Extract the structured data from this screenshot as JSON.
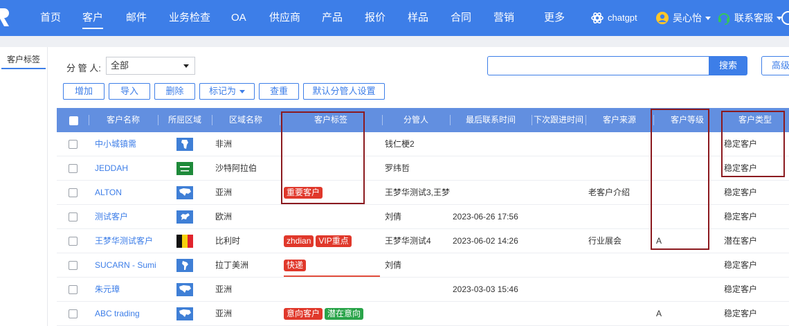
{
  "nav": {
    "items": [
      {
        "label": "首页",
        "active": false
      },
      {
        "label": "客户",
        "active": true
      },
      {
        "label": "邮件",
        "active": false
      },
      {
        "label": "业务检查",
        "active": false
      },
      {
        "label": "OA",
        "active": false
      },
      {
        "label": "供应商",
        "active": false
      },
      {
        "label": "产品",
        "active": false
      },
      {
        "label": "报价",
        "active": false
      },
      {
        "label": "样品",
        "active": false
      },
      {
        "label": "合同",
        "active": false
      },
      {
        "label": "营销",
        "active": false
      },
      {
        "label": "更多",
        "active": false
      }
    ],
    "chatgpt_label": "chatgpt",
    "user_name": "吴心怡",
    "support_label": "联系客服"
  },
  "sidebar": {
    "tab_label": "客户标签"
  },
  "filter": {
    "manager_label": "分 管 人:",
    "manager_value": "全部",
    "search_value": "",
    "search_button": "搜索",
    "advanced_button": "高级"
  },
  "toolbar": {
    "add": "增加",
    "import": "导入",
    "delete": "删除",
    "mark_as": "标记为",
    "check": "查重",
    "default_manager": "默认分管人设置"
  },
  "table": {
    "columns": [
      "客户名称",
      "所屈区域",
      "区域名称",
      "客户标签",
      "分管人",
      "最后联系时间",
      "下次跟进时间",
      "客户来源",
      "客户等级",
      "客户类型"
    ],
    "rows": [
      {
        "name": "中小城镇需",
        "flag": "africa-map",
        "region": "非洲",
        "tags": [],
        "manager": "钱仁梗2",
        "last_contact": "",
        "next_followup": "",
        "source": "",
        "level": "",
        "type": "稳定客户"
      },
      {
        "name": "JEDDAH",
        "flag": "saudi-arabia-flag",
        "region": "沙特阿拉伯",
        "tags": [],
        "manager": "罗纬哲",
        "last_contact": "",
        "next_followup": "",
        "source": "",
        "level": "",
        "type": "稳定客户"
      },
      {
        "name": "ALTON",
        "flag": "asia-map",
        "region": "亚洲",
        "tags": [
          {
            "label": "重要客户",
            "color": "#e0382b"
          }
        ],
        "manager": "王梦华测试3,王梦",
        "last_contact": "",
        "next_followup": "",
        "source": "老客户介绍",
        "level": "",
        "type": "稳定客户"
      },
      {
        "name": "测试客户",
        "flag": "europe-map",
        "region": "欧洲",
        "tags": [],
        "manager": "刘倩",
        "last_contact": "2023-06-26 17:56",
        "next_followup": "",
        "source": "",
        "level": "",
        "type": "稳定客户"
      },
      {
        "name": "王梦华测试客户",
        "flag": "belgium-flag",
        "region": "比利时",
        "tags": [
          {
            "label": "zhdian",
            "color": "#e0382b"
          },
          {
            "label": "VIP重点",
            "color": "#e0382b"
          }
        ],
        "manager": "王梦华测试4",
        "last_contact": "2023-06-02 14:26",
        "next_followup": "",
        "source": "行业展会",
        "level": "A",
        "type": "潜在客户"
      },
      {
        "name": "SUCARN - Sumi",
        "flag": "latin-america-map",
        "region": "拉丁美洲",
        "tags": [
          {
            "label": "快递",
            "color": "#e0382b"
          }
        ],
        "manager": "刘倩",
        "last_contact": "",
        "next_followup": "",
        "source": "",
        "level": "",
        "type": "稳定客户"
      },
      {
        "name": "朱元璋",
        "flag": "asia-map",
        "region": "亚洲",
        "tags": [],
        "manager": "",
        "last_contact": "2023-03-03 15:46",
        "next_followup": "",
        "source": "",
        "level": "",
        "type": "稳定客户"
      },
      {
        "name": "ABC trading",
        "flag": "asia-map",
        "region": "亚洲",
        "tags": [
          {
            "label": "意向客户",
            "color": "#e0382b"
          },
          {
            "label": "潜在意向",
            "color": "#2aa44a"
          }
        ],
        "manager": "",
        "last_contact": "",
        "next_followup": "",
        "source": "",
        "level": "A",
        "type": "稳定客户"
      }
    ]
  },
  "colors": {
    "nav_bg": "#3d7ee8",
    "table_header_bg": "#628fe0",
    "link": "#3d7ee8",
    "tag_red": "#e0382b",
    "tag_green": "#2aa44a",
    "annotation_box": "#8b1a1f"
  }
}
